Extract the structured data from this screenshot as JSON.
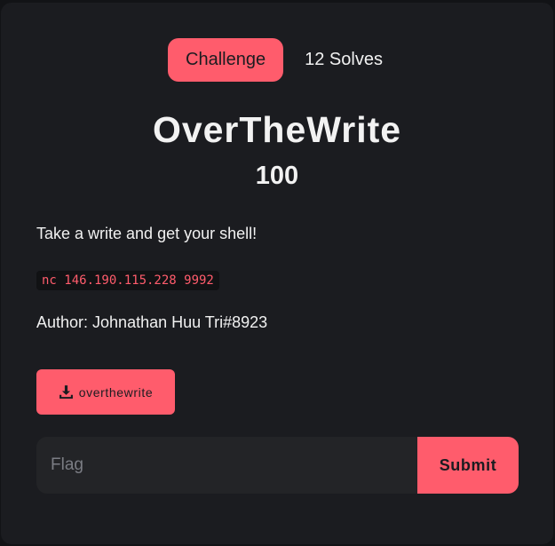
{
  "tabs": {
    "active_label": "Challenge",
    "solves_label": "12 Solves"
  },
  "challenge": {
    "name": "OverTheWrite",
    "points": "100",
    "description": "Take a write and get your shell!",
    "connection": "nc 146.190.115.228 9992",
    "author": "Author: Johnathan Huu Tri#8923"
  },
  "download": {
    "icon": "download-icon",
    "label": "overthewrite"
  },
  "flag_form": {
    "placeholder": "Flag",
    "value": "",
    "submit_label": "Submit"
  },
  "colors": {
    "accent": "#ff5c6c",
    "background": "#1b1c20",
    "text": "#f1f1f1"
  }
}
